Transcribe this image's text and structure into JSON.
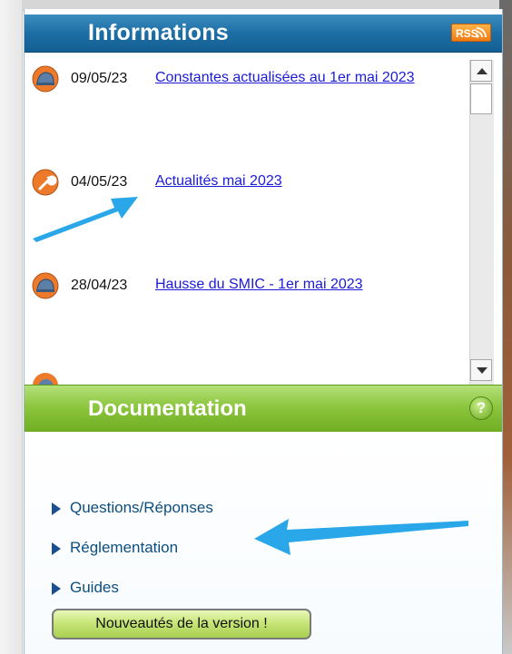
{
  "informations": {
    "title": "Informations",
    "rss_label": "RSS",
    "items": [
      {
        "date": "09/05/23",
        "title": "Constantes actualisées au 1er mai 2023",
        "icon": "helmet-icon"
      },
      {
        "date": "04/05/23",
        "title": "Actualités mai 2023",
        "icon": "wrench-icon"
      },
      {
        "date": "28/04/23",
        "title": "Hausse du SMIC - 1er mai 2023",
        "icon": "helmet-icon"
      }
    ]
  },
  "documentation": {
    "title": "Documentation",
    "help_label": "?",
    "links": [
      {
        "label": "Questions/Réponses"
      },
      {
        "label": "Réglementation"
      },
      {
        "label": "Guides"
      }
    ],
    "version_button": "Nouveautés de la version !"
  },
  "colors": {
    "info_header": "#1d6ea5",
    "doc_header": "#8dc63f",
    "link_blue": "#1a1ad8",
    "annotation_arrow": "#29a7e8"
  }
}
